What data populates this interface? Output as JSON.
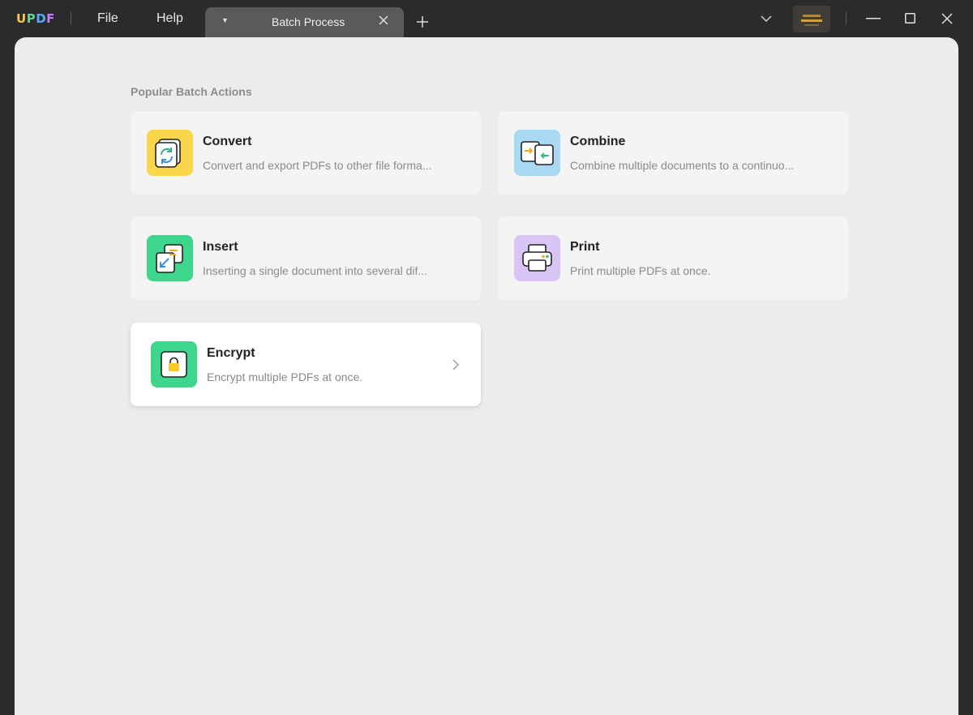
{
  "app": {
    "logo_letters": [
      "U",
      "P",
      "D",
      "F"
    ],
    "colors": {
      "titlebar_bg": "#2b2b2d",
      "content_bg": "#ececec",
      "card_bg": "#f4f4f4"
    }
  },
  "menu": {
    "file": "File",
    "help": "Help"
  },
  "tab": {
    "title": "Batch Process"
  },
  "main": {
    "section_title": "Popular Batch Actions",
    "cards": [
      {
        "title": "Convert",
        "description": "Convert and export PDFs to other file forma...",
        "icon": "convert-icon",
        "icon_color": "#f9d64a"
      },
      {
        "title": "Combine",
        "description": "Combine multiple documents to a continuo...",
        "icon": "combine-icon",
        "icon_color": "#a9d8f2"
      },
      {
        "title": "Insert",
        "description": "Inserting a single document into several dif...",
        "icon": "insert-icon",
        "icon_color": "#3ed68c"
      },
      {
        "title": "Print",
        "description": "Print multiple PDFs at once.",
        "icon": "print-icon",
        "icon_color": "#d9c4f6"
      },
      {
        "title": "Encrypt",
        "description": "Encrypt multiple PDFs at once.",
        "icon": "lock-icon",
        "icon_color": "#3ed68c"
      }
    ]
  }
}
